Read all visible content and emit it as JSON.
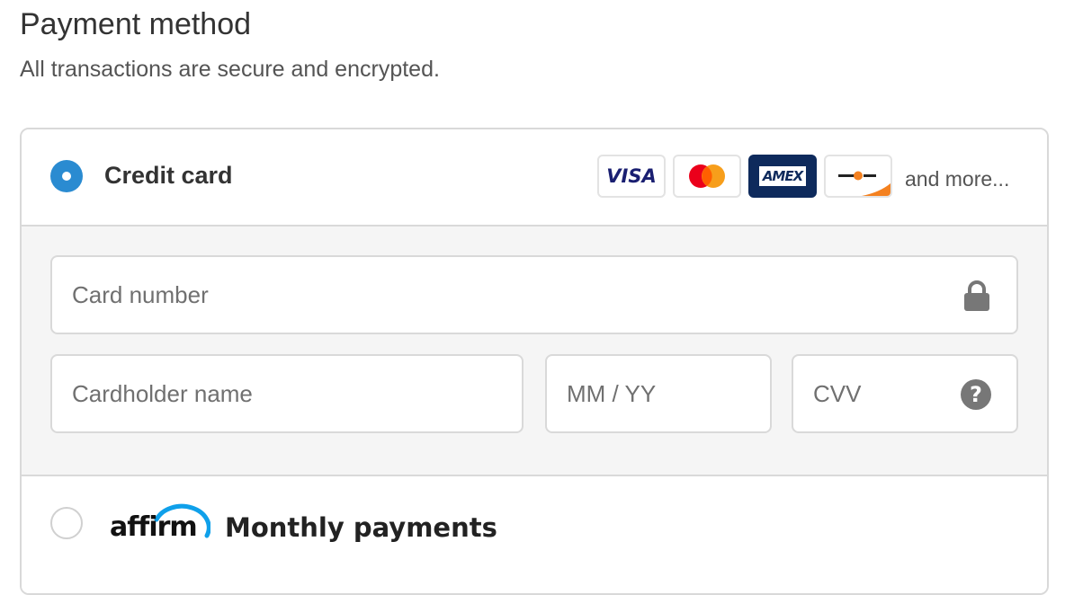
{
  "header": {
    "title": "Payment method",
    "subtitle": "All transactions are secure and encrypted."
  },
  "credit_card": {
    "label": "Credit card",
    "selected": true,
    "radio_color": "#2a8bd1",
    "logos": {
      "visa": "VISA",
      "mastercard": "mastercard-logo",
      "amex": "AMEX",
      "discover": "discover-logo"
    },
    "and_more": "and more...",
    "fields": {
      "card_number": {
        "placeholder": "Card number",
        "icon": "lock-icon"
      },
      "cardholder_name": {
        "placeholder": "Cardholder name"
      },
      "expiry": {
        "placeholder": "MM / YY"
      },
      "cvv": {
        "placeholder": "CVV",
        "icon": "help-icon",
        "icon_glyph": "?"
      }
    }
  },
  "affirm": {
    "logo_text": "affirm",
    "label": "Monthly payments",
    "selected": false,
    "arc_color": "#0fa0ea"
  }
}
